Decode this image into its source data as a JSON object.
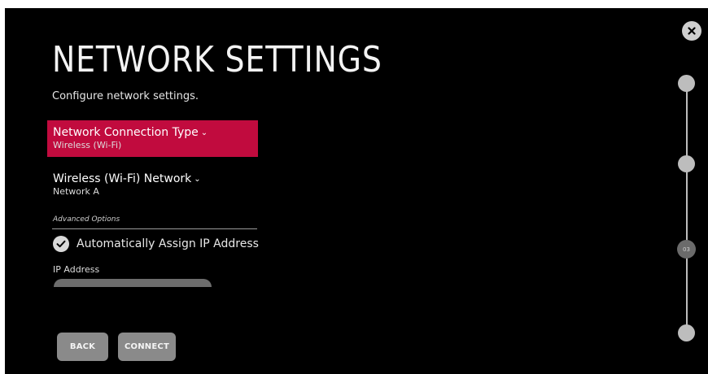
{
  "page": {
    "title": "NETWORK SETTINGS",
    "subtitle": "Configure network settings."
  },
  "menu": {
    "connection_type": {
      "label": "Network Connection Type",
      "value": "Wireless (Wi-Fi)"
    },
    "wifi_network": {
      "label": "Wireless (Wi-Fi) Network",
      "value": "Network A"
    }
  },
  "advanced": {
    "section_label": "Advanced Options",
    "auto_ip_label": "Automatically Assign IP Address",
    "auto_ip_checked": true,
    "ip_address_label": "IP Address",
    "ip_address_value": ""
  },
  "buttons": {
    "back": "BACK",
    "connect": "CONNECT"
  },
  "progress": {
    "current_step_label": "03"
  },
  "colors": {
    "selected_item": "#c10b3e",
    "background": "#000000",
    "button": "#8a8a8a"
  },
  "icons": {
    "close": "close-icon",
    "dropdown": "chevron-down-icon",
    "check": "checkmark-icon"
  }
}
